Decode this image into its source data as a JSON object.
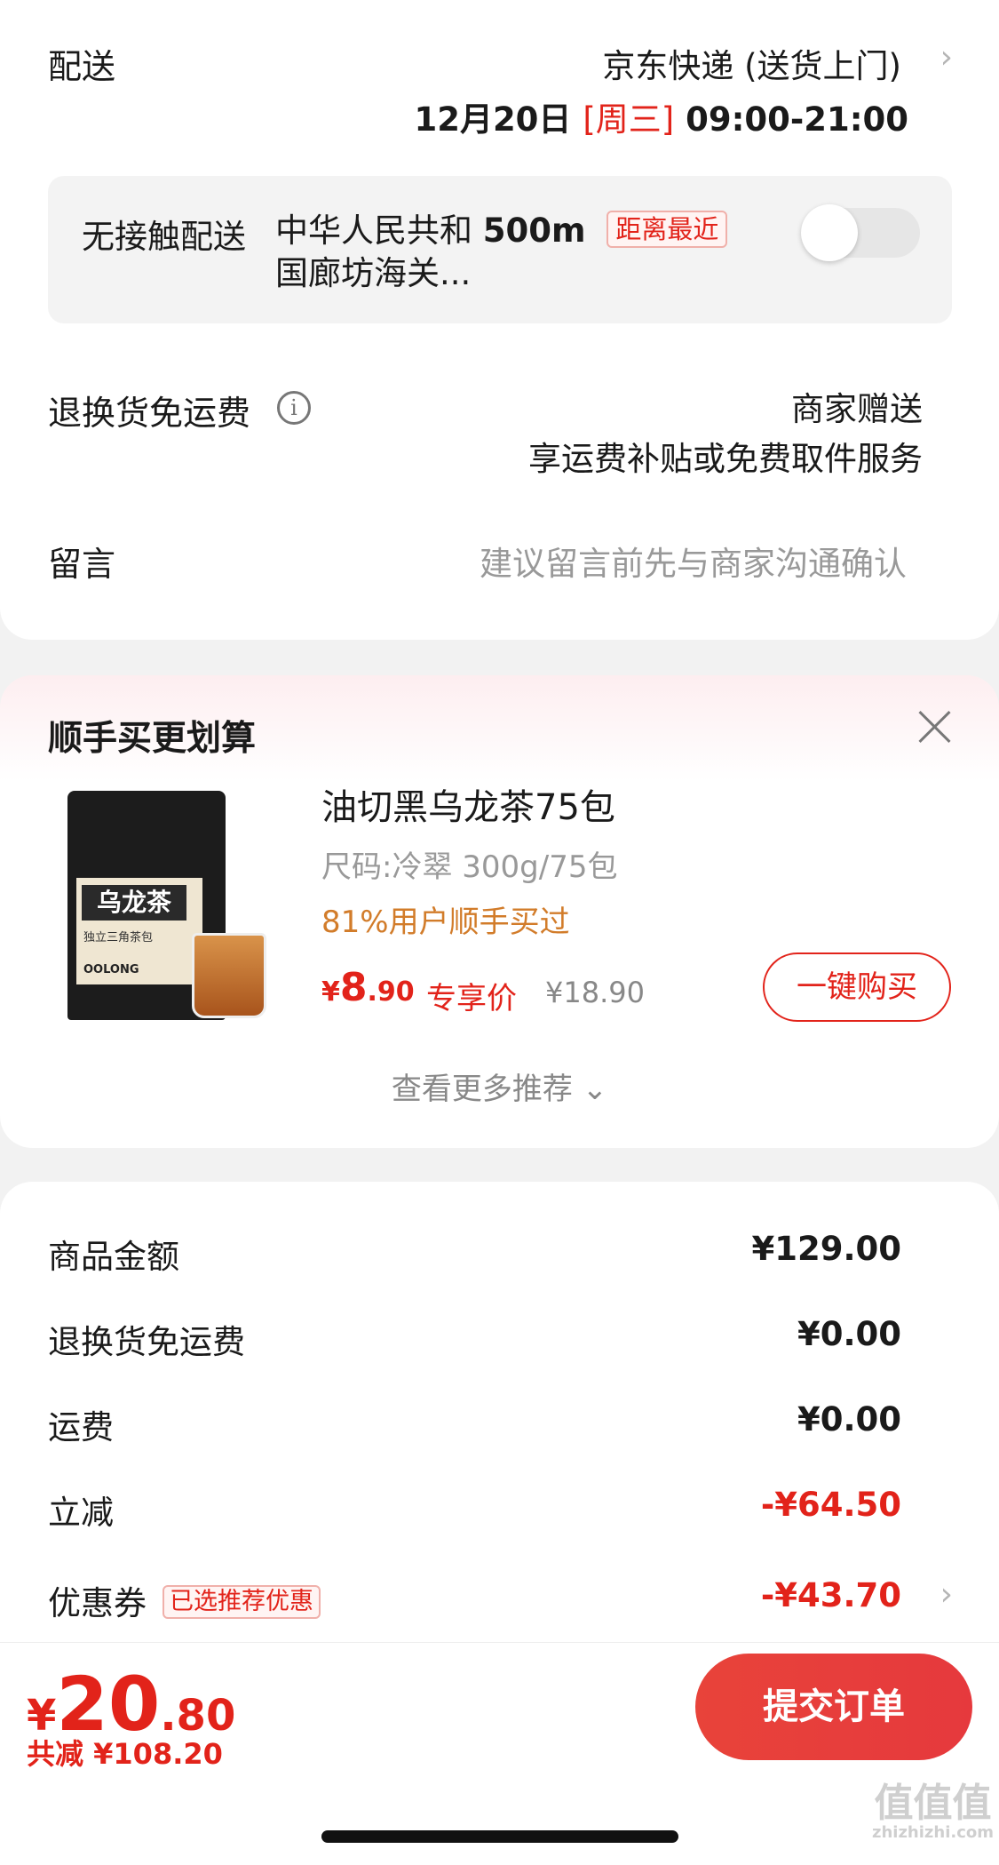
{
  "delivery": {
    "label": "配送",
    "method": "京东快递 (送货上门)",
    "date": "12月20日",
    "weekday": "[周三]",
    "time": "09:00-21:00",
    "contactless_label": "无接触配送",
    "address_line1": "中华人民共和",
    "distance": "500m",
    "distance_tag": "距离最近",
    "address_line2": "国廊坊海关...",
    "toggle_on": false
  },
  "returns": {
    "label": "退换货免运费",
    "value1": "商家赠送",
    "value2": "享运费补贴或免费取件服务"
  },
  "message": {
    "label": "留言",
    "placeholder": "建议留言前先与商家沟通确认"
  },
  "recommend": {
    "title": "顺手买更划算",
    "product": {
      "image_brand": "乌龙茶",
      "image_sub": "独立三角茶包",
      "image_en": "OOLONG",
      "name": "油切黑乌龙茶75包",
      "spec": "尺码:冷翠 300g/75包",
      "buyers": "81%用户顺手买过",
      "price_symbol": "¥",
      "price_int": "8",
      "price_dec": ".90",
      "exclusive": "专享价",
      "orig_price": "¥18.90",
      "buy_label": "一键购买"
    },
    "see_more": "查看更多推荐 ⌄"
  },
  "summary": {
    "rows": [
      {
        "label": "商品金额",
        "value": "¥129.00"
      },
      {
        "label": "退换货免运费",
        "value": "¥0.00"
      },
      {
        "label": "运费",
        "value": "¥0.00"
      },
      {
        "label": "立减",
        "value": "-¥64.50"
      },
      {
        "label": "优惠券",
        "tag": "已选推荐优惠",
        "value": "-¥43.70"
      }
    ]
  },
  "checkout": {
    "symbol": "¥",
    "total_int": "20",
    "total_dec": ".80",
    "saved": "共减 ¥108.20",
    "submit_label": "提交订单"
  },
  "watermark": {
    "main": "值值值",
    "sub": "zhizhizhi.com"
  },
  "colors": {
    "accent": "#e2231a",
    "orange": "#d27c2a",
    "muted": "#999999"
  }
}
